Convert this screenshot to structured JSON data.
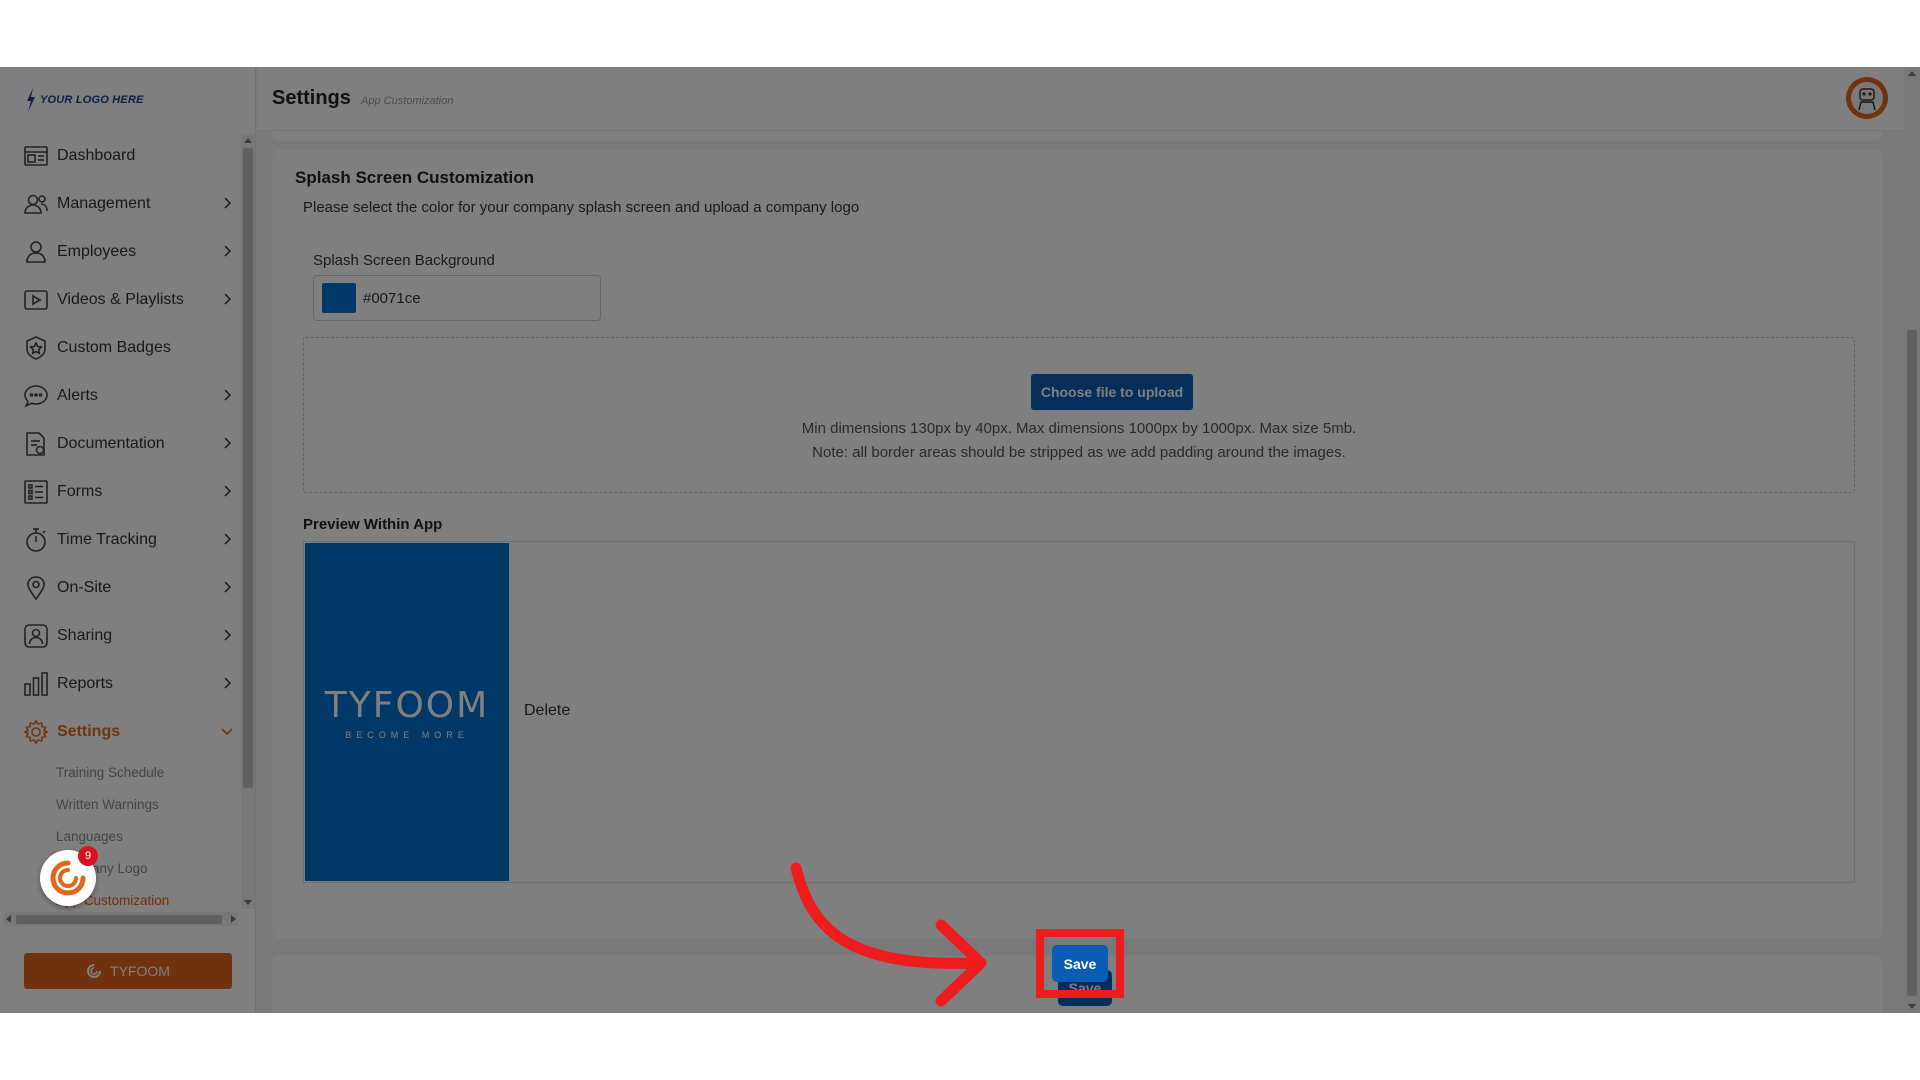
{
  "brand": {
    "logo_text": "YOUR LOGO HERE",
    "button_label": "TYFOOM",
    "chat_badge_count": "9"
  },
  "header": {
    "title": "Settings",
    "breadcrumb": "App Customization"
  },
  "sidebar": {
    "items": [
      {
        "label": "Dashboard",
        "icon": "dashboard-icon",
        "has_children": false
      },
      {
        "label": "Management",
        "icon": "management-icon",
        "has_children": true
      },
      {
        "label": "Employees",
        "icon": "user-icon",
        "has_children": true
      },
      {
        "label": "Videos & Playlists",
        "icon": "play-icon",
        "has_children": true
      },
      {
        "label": "Custom Badges",
        "icon": "badge-icon",
        "has_children": false
      },
      {
        "label": "Alerts",
        "icon": "alert-bubble-icon",
        "has_children": true
      },
      {
        "label": "Documentation",
        "icon": "document-icon",
        "has_children": true
      },
      {
        "label": "Forms",
        "icon": "form-list-icon",
        "has_children": true
      },
      {
        "label": "Time Tracking",
        "icon": "stopwatch-icon",
        "has_children": true
      },
      {
        "label": "On-Site",
        "icon": "location-pin-icon",
        "has_children": true
      },
      {
        "label": "Sharing",
        "icon": "share-user-icon",
        "has_children": true
      },
      {
        "label": "Reports",
        "icon": "bar-chart-icon",
        "has_children": true
      },
      {
        "label": "Settings",
        "icon": "gear-icon",
        "has_children": true,
        "active": true,
        "expanded": true
      }
    ],
    "settings_submenu": [
      {
        "label": "Training Schedule"
      },
      {
        "label": "Written Warnings"
      },
      {
        "label": "Languages"
      },
      {
        "label": "Company Logo"
      },
      {
        "label": "App Customization",
        "active": true
      }
    ]
  },
  "splash": {
    "title": "Splash Screen Customization",
    "description": "Please select the color for your company splash screen and upload a company logo",
    "background_label": "Splash Screen Background",
    "background_value": "#0071ce",
    "upload_button": "Choose file to upload",
    "upload_note_1": "Min dimensions 130px by 40px. Max dimensions 1000px by 1000px. Max size 5mb.",
    "upload_note_2": "Note: all border areas should be stripped as we add padding around the images.",
    "preview_title": "Preview Within App",
    "preview_logo_text": "TYFOOM",
    "preview_tagline": "BECOME MORE",
    "delete_label": "Delete"
  },
  "footer": {
    "save_label": "Save"
  },
  "colors": {
    "accent_orange": "#e0671a",
    "primary_blue": "#0b5cb5",
    "splash_background": "#0071ce",
    "annotation_red": "#ee1c1c"
  }
}
